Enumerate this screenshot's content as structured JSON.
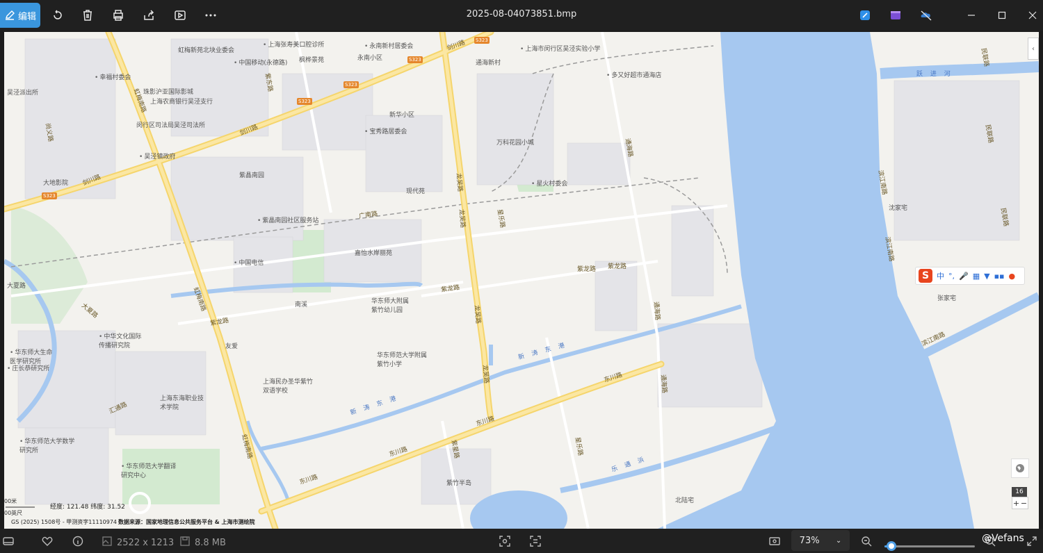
{
  "toolbar": {
    "edit_label": "编辑",
    "icons": [
      "rotate-icon",
      "delete-icon",
      "print-icon",
      "share-icon",
      "slideshow-icon",
      "more-icon"
    ],
    "file_title": "2025-08-04073851.bmp",
    "right_icons": [
      "designer-icon",
      "clipchamp-icon",
      "onedrive-off-icon"
    ],
    "window_buttons": [
      "minimize",
      "maximize",
      "close"
    ]
  },
  "map": {
    "colors": {
      "water": "#a6c8f0",
      "land": "#f3f2ee",
      "green": "#cfe8c8",
      "highway": "#f7d774",
      "building": "#e6e6e8"
    },
    "places": [
      {
        "text": "上海张寿美口腔诊所",
        "poi": true
      },
      {
        "text": "永南新村居委会",
        "poi": true
      },
      {
        "text": "上海市闵行区吴泾实验小学",
        "poi": true
      },
      {
        "text": "虹梅新苑北块业委会",
        "poi": false
      },
      {
        "text": "中国移动(永德路)",
        "poi": true
      },
      {
        "text": "枫桦景苑",
        "poi": false
      },
      {
        "text": "永南小区",
        "poi": false
      },
      {
        "text": "通海新村",
        "poi": false
      },
      {
        "text": "多又好超市通海店",
        "poi": true
      },
      {
        "text": "幸福村委会",
        "poi": true
      },
      {
        "text": "吴泾派出所",
        "poi": false
      },
      {
        "text": "珠影沪亚国际影城",
        "poi": false
      },
      {
        "text": "上海农商银行吴泾支行",
        "poi": false
      },
      {
        "text": "闵行区司法局吴泾司法所",
        "poi": false
      },
      {
        "text": "新华小区",
        "poi": false
      },
      {
        "text": "宝秀路居委会",
        "poi": true
      },
      {
        "text": "万科花园小城",
        "poi": false
      },
      {
        "text": "吴泾镇政府",
        "poi": true
      },
      {
        "text": "大地影院",
        "poi": false
      },
      {
        "text": "紫晶南园",
        "poi": false
      },
      {
        "text": "现代苑",
        "poi": false
      },
      {
        "text": "星火村委会",
        "poi": true
      },
      {
        "text": "紫晶南园社区服务站",
        "poi": true
      },
      {
        "text": "嘉怡水岸丽苑",
        "poi": false
      },
      {
        "text": "中国电信",
        "poi": true
      },
      {
        "text": "华东师大附属紫竹幼儿园",
        "poi": false
      },
      {
        "text": "南溪",
        "poi": false
      },
      {
        "text": "中华文化国际传播研究院",
        "poi": true
      },
      {
        "text": "友爱",
        "poi": false
      },
      {
        "text": "华东师范大学附属紫竹小学",
        "poi": false
      },
      {
        "text": "华东师大生命医学研究所",
        "poi": true
      },
      {
        "text": "庄长恭研究所",
        "poi": true
      },
      {
        "text": "上海民办圣华紫竹双语学校",
        "poi": false
      },
      {
        "text": "上海东海职业技术学院",
        "poi": false
      },
      {
        "text": "华东师范大学数学研究所",
        "poi": true
      },
      {
        "text": "华东师范大学翻译研究中心",
        "poi": true
      },
      {
        "text": "紫竹半岛",
        "poi": false
      },
      {
        "text": "北陆宅",
        "poi": false
      },
      {
        "text": "沈家宅",
        "poi": false
      },
      {
        "text": "张家宅",
        "poi": false
      },
      {
        "text": "大夏路",
        "poi": false
      }
    ],
    "roads": [
      "剑川路",
      "S323",
      "虹梅南路",
      "龙吴路",
      "紫龙路",
      "东川路",
      "广南路",
      "通海路",
      "紫东路",
      "星乐路",
      "汇通路",
      "民联路",
      "滨江南路",
      "紫星路",
      "尚义路"
    ],
    "water_labels": [
      "新 涛 东 港",
      "新 涛 东 港",
      "乐 通 浜",
      "跃 进 河"
    ],
    "map_zoom": "16",
    "scale_top": "00米",
    "scale_bottom": "00英尺",
    "coords": "经度: 121.48   纬度: 31.52",
    "credits": "GS (2025) 1508号 - 甲测资字11110974",
    "credits_source": "数据来源：国家地理信息公共服务平台 & 上海市测绘院",
    "ime": {
      "label_cn": "中",
      "items": [
        "°,",
        "mic",
        "keyboard",
        "shirt",
        "grid",
        "tools"
      ]
    }
  },
  "statusbar": {
    "dimensions": "2522 x 1213",
    "filesize": "8.8 MB",
    "zoom": "73%",
    "zoom_fraction": 0.08,
    "watermark": "@Vefans"
  }
}
